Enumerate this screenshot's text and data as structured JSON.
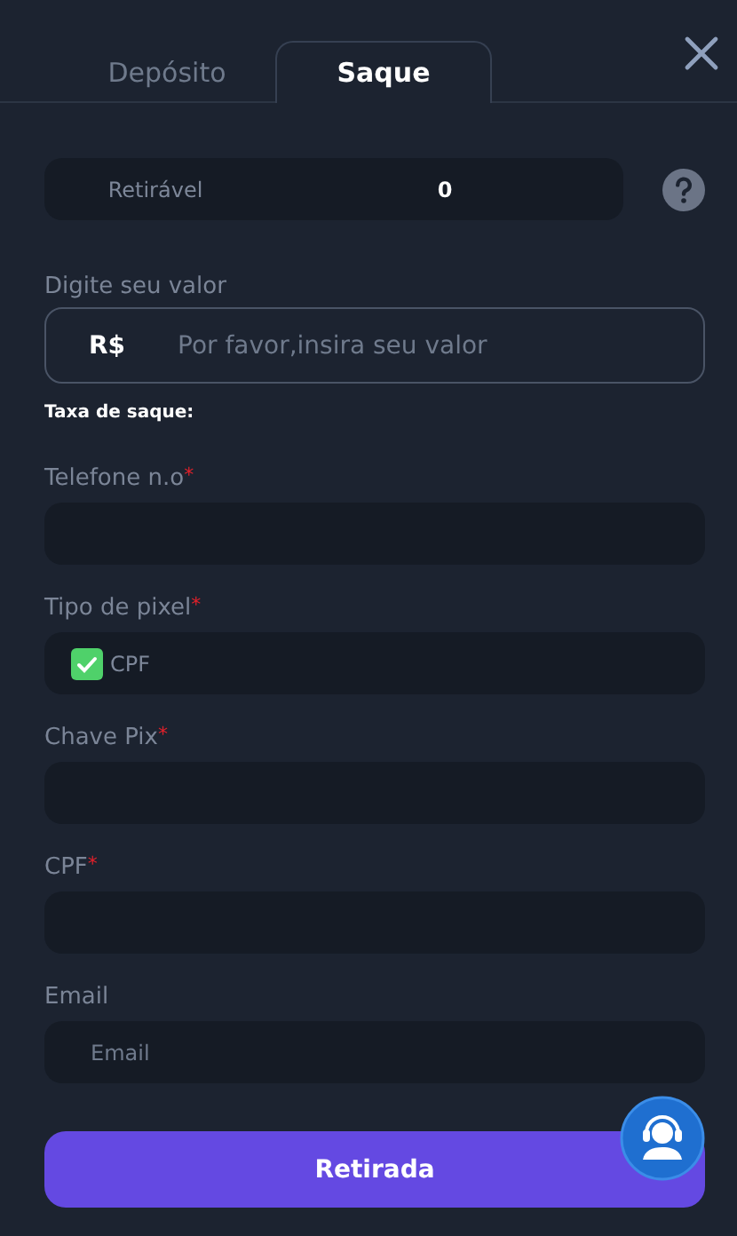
{
  "tabs": [
    {
      "label": "Depósito",
      "selected": false
    },
    {
      "label": "Saque",
      "selected": true
    }
  ],
  "balance": {
    "label": "Retirável",
    "value": "0"
  },
  "amount": {
    "label": "Digite seu valor",
    "currency": "R$",
    "placeholder": "Por favor,insira seu valor"
  },
  "fee_label": "Taxa de saque:",
  "fields": [
    {
      "kind": "text",
      "label": "Telefone n.o",
      "required_mark": "*"
    },
    {
      "kind": "checkbox",
      "label": "Tipo de pixel",
      "required_mark": "*",
      "option": "CPF",
      "checked": true
    },
    {
      "kind": "text",
      "label": "Chave Pix",
      "required_mark": "*"
    },
    {
      "kind": "text",
      "label": "CPF",
      "required_mark": "*"
    },
    {
      "kind": "text",
      "label": "Email",
      "placeholder": "Email"
    }
  ],
  "submit": "Retirada"
}
